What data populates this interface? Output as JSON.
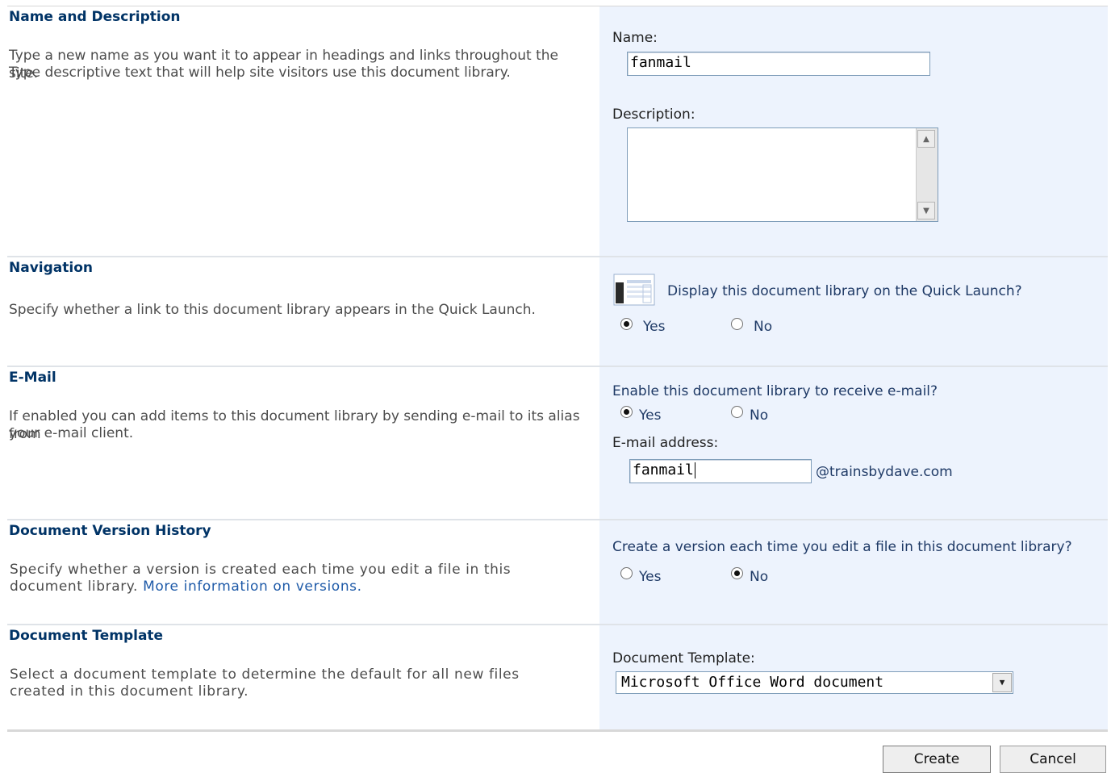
{
  "sections": {
    "name_description": {
      "heading": "Name and Description",
      "desc_line1": "Type a new name as you want it to appear in headings and links throughout the site.",
      "desc_line2": "Type descriptive text that will help site visitors use this document library.",
      "name_label": "Name:",
      "name_value": "fanmail",
      "description_label": "Description:",
      "description_value": ""
    },
    "navigation": {
      "heading": "Navigation",
      "desc": "Specify whether a link to this document library appears in the Quick Launch.",
      "question": "Display this document library on the Quick Launch?",
      "yes_label": "Yes",
      "no_label": "No",
      "selected": "Yes"
    },
    "email": {
      "heading": "E-Mail",
      "desc_line1": "If enabled you can add items to this document library by sending e-mail to its alias from",
      "desc_line2": "your e-mail client.",
      "question": "Enable this document library to receive e-mail?",
      "yes_label": "Yes",
      "no_label": "No",
      "selected": "Yes",
      "address_label": "E-mail address:",
      "address_value": "fanmail",
      "domain_suffix": "@trainsbydave.com"
    },
    "versioning": {
      "heading": "Document Version History",
      "desc_line1": "Specify whether a version is created each time you edit a file in this",
      "desc_line2": "document library.",
      "more_info_link": "More information on versions.",
      "question": "Create a version each time you edit a file in this document library?",
      "yes_label": "Yes",
      "no_label": "No",
      "selected": "No"
    },
    "template": {
      "heading": "Document Template",
      "desc_line1": "Select a document template to determine the default for all new files",
      "desc_line2": "created in this document library.",
      "label": "Document Template:",
      "selected_value": "Microsoft Office Word document"
    }
  },
  "actions": {
    "create_label": "Create",
    "cancel_label": "Cancel"
  },
  "colors": {
    "heading": "#003366",
    "right_panel_bg": "#edf3fd",
    "link": "#1e5aa8"
  }
}
